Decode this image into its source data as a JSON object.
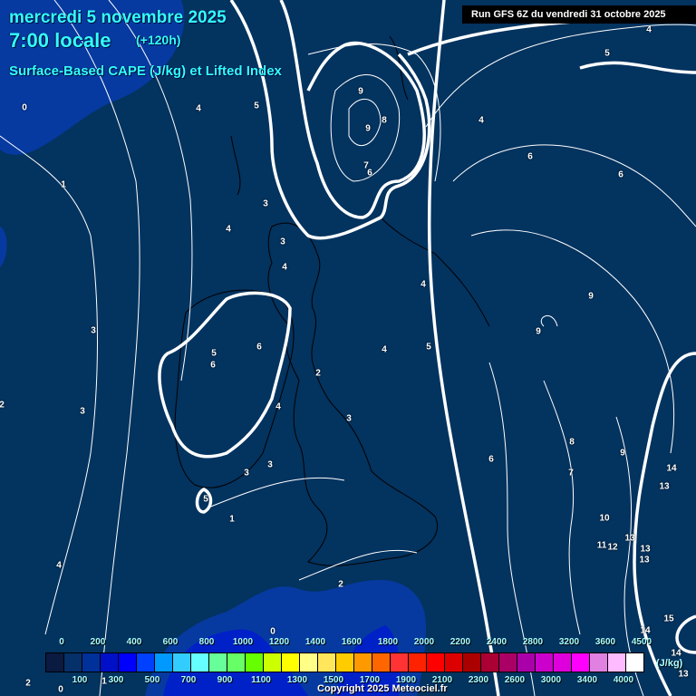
{
  "header": {
    "date": "mercredi 5 novembre 2025",
    "time": "7:00 locale",
    "lead": "(+120h)",
    "parameter": "Surface-Based CAPE (J/kg) et Lifted Index",
    "run": "Run GFS 6Z du vendredi 31 octobre 2025"
  },
  "contour_labels": [
    "4",
    "5",
    "0",
    "4",
    "5",
    "9",
    "8",
    "9",
    "4",
    "6",
    "6",
    "7",
    "6",
    "1",
    "3",
    "4",
    "3",
    "4",
    "4",
    "9",
    "9",
    "3",
    "6",
    "5",
    "6",
    "4",
    "5",
    "2",
    "4",
    "3",
    "2",
    "3",
    "8",
    "9",
    "6",
    "3",
    "3",
    "7",
    "14",
    "13",
    "5",
    "1",
    "10",
    "11",
    "12",
    "13",
    "13",
    "13",
    "4",
    "2",
    "0",
    "15",
    "14",
    "14",
    "13",
    "2",
    "1",
    "0"
  ],
  "legend": {
    "unit": "(J/kg)",
    "top_labels": [
      "0",
      "200",
      "400",
      "600",
      "800",
      "1000",
      "1200",
      "1400",
      "1600",
      "1800",
      "2000",
      "2200",
      "2400",
      "2800",
      "3200",
      "3600",
      "4500"
    ],
    "bottom_labels": [
      "100",
      "300",
      "500",
      "700",
      "900",
      "1100",
      "1300",
      "1500",
      "1700",
      "1900",
      "2100",
      "2300",
      "2600",
      "3000",
      "3400",
      "4000"
    ],
    "colors": [
      "#0a1a40",
      "#06306a",
      "#00309a",
      "#0010c8",
      "#0000ff",
      "#0040ff",
      "#0099ff",
      "#33ccff",
      "#66ffff",
      "#66ff99",
      "#66ff66",
      "#66ff00",
      "#ccff00",
      "#ffff00",
      "#ffff88",
      "#ffe65a",
      "#ffcc00",
      "#ff9900",
      "#ff6600",
      "#ff3333",
      "#ff2200",
      "#ff0000",
      "#dd0000",
      "#aa0000",
      "#aa0033",
      "#aa0066",
      "#aa00aa",
      "#cc00cc",
      "#dd00dd",
      "#ff00ff",
      "#e080e0",
      "#ffbbff",
      "#ffffff"
    ]
  },
  "copyright": "Copyright 2025 Meteociel.fr"
}
